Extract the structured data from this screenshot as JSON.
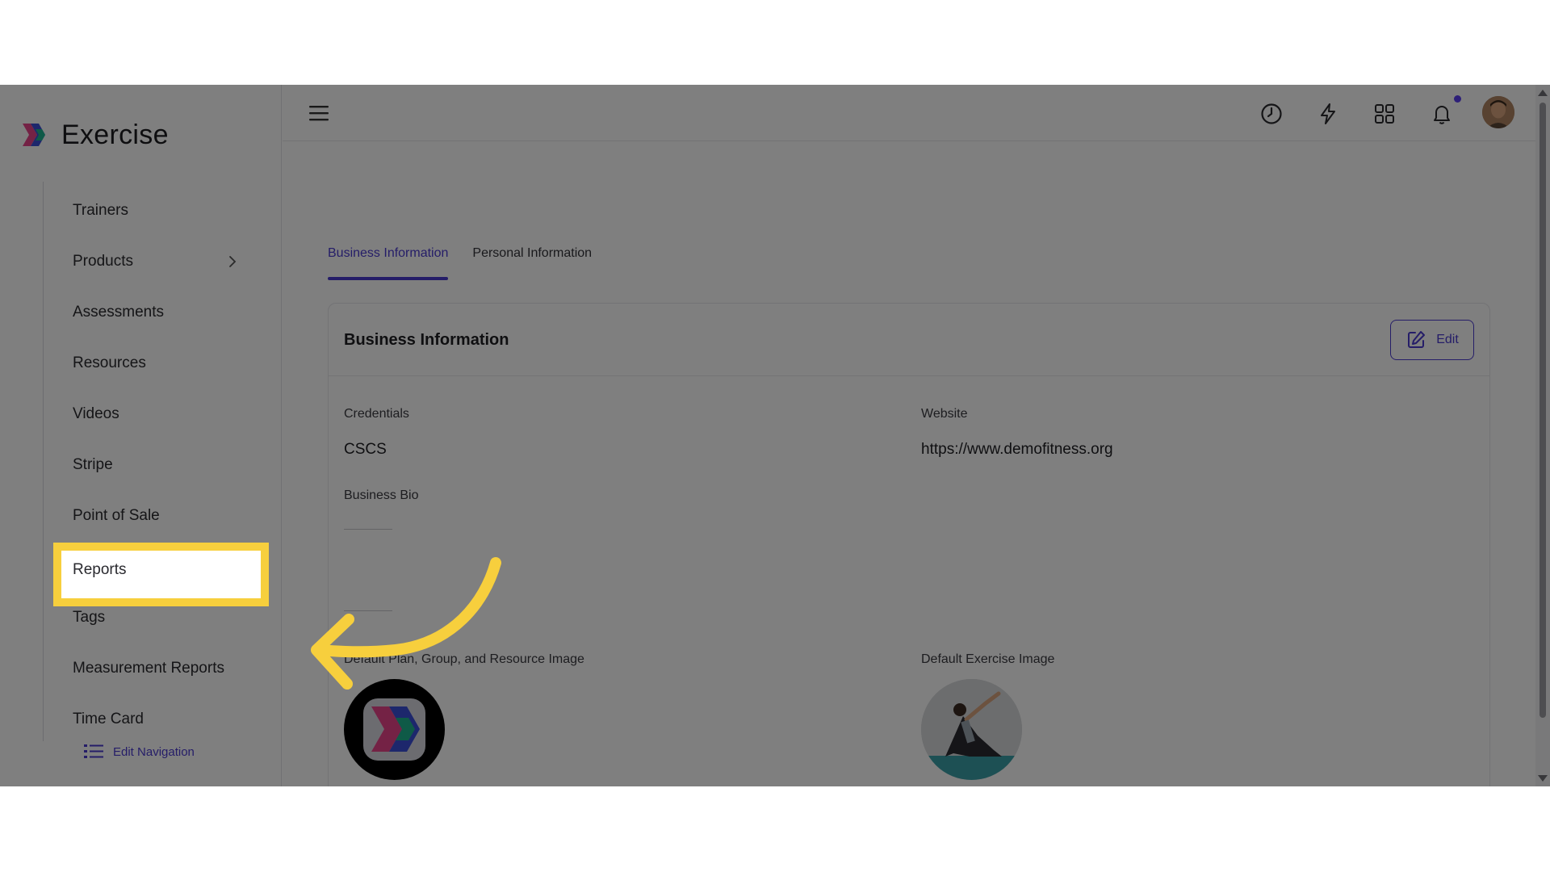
{
  "app": {
    "name": "Exercise"
  },
  "sidebar": {
    "items": [
      {
        "label": "Trainers"
      },
      {
        "label": "Products",
        "has_submenu": true
      },
      {
        "label": "Assessments"
      },
      {
        "label": "Resources"
      },
      {
        "label": "Videos"
      },
      {
        "label": "Stripe"
      },
      {
        "label": "Point of Sale"
      },
      {
        "label": "Reports",
        "highlighted": true
      },
      {
        "label": "Tags"
      },
      {
        "label": "Measurement Reports"
      },
      {
        "label": "Time Card"
      }
    ],
    "edit_navigation_label": "Edit Navigation"
  },
  "topbar": {
    "icons": [
      "menu-icon",
      "history-clock-icon",
      "lightning-icon",
      "apps-grid-icon",
      "bell-icon",
      "user-avatar"
    ],
    "has_notification": true
  },
  "tabs": [
    {
      "label": "Business Information",
      "active": true
    },
    {
      "label": "Personal Information",
      "active": false
    }
  ],
  "business_card": {
    "title": "Business Information",
    "edit_label": "Edit",
    "credentials_label": "Credentials",
    "credentials_value": "CSCS",
    "website_label": "Website",
    "website_value": "https://www.demofitness.org",
    "bio_label": "Business Bio",
    "default_plan_image_label": "Default Plan, Group, and Resource Image",
    "default_exercise_image_label": "Default Exercise Image"
  },
  "colors": {
    "accent": "#4a3bd0",
    "highlight": "#f7cf3d",
    "overlay": "rgba(0,0,0,0.5)"
  }
}
